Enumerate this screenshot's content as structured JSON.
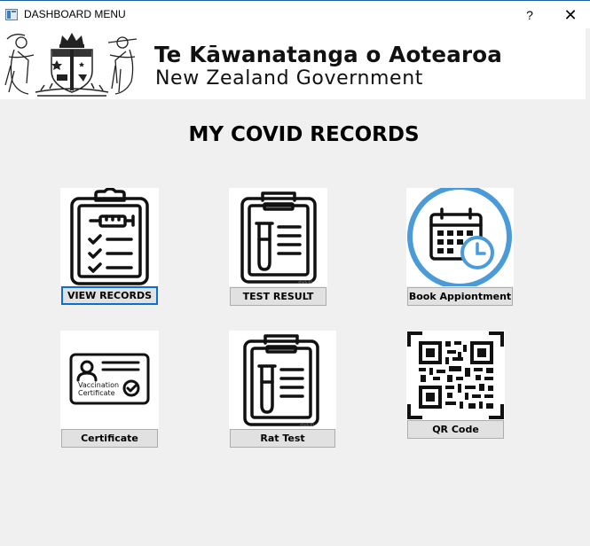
{
  "window": {
    "title": "DASHBOARD MENU",
    "help_label": "?",
    "close_label": "✕"
  },
  "banner": {
    "maori_title": "Te Kāwanatanga o Aotearoa",
    "english_title": "New Zealand Government"
  },
  "page": {
    "title": "MY COVID RECORDS"
  },
  "tiles": {
    "view_records": "VIEW RECORDS",
    "test_result": "TEST RESULT",
    "book_appointment": "Book Appiontment",
    "certificate": "Certificate",
    "rat_test": "Rat Test",
    "qr_code": "QR Code"
  },
  "certificate_card": {
    "line1": "Vaccination",
    "line2": "Certificate"
  },
  "colors": {
    "focus_border": "#0b6fd0",
    "calendar_ring": "#4a9bd8",
    "titlebar_accent": "#1f5fa0"
  }
}
